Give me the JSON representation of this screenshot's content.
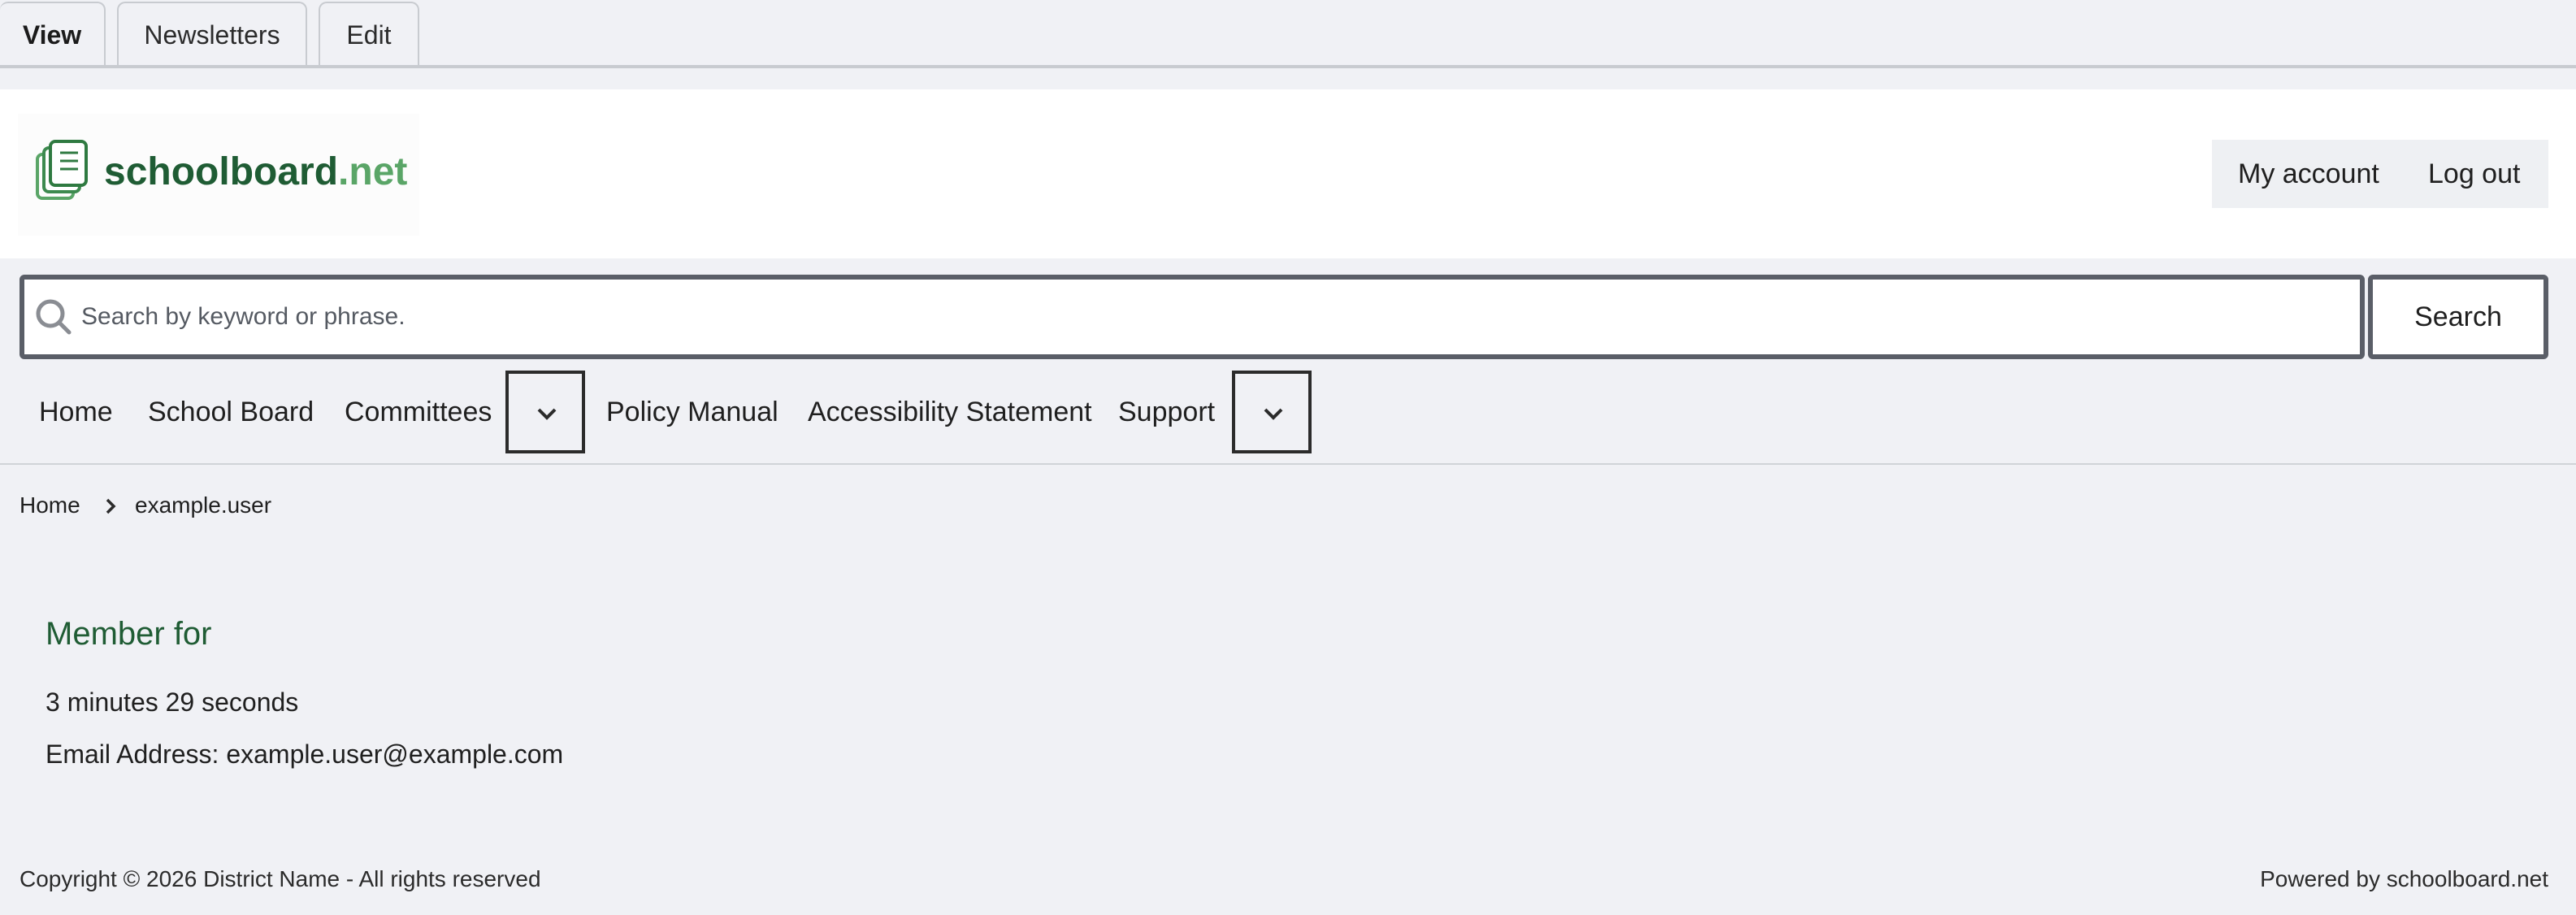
{
  "tabs": [
    {
      "label": "View",
      "active": true
    },
    {
      "label": "Newsletters",
      "active": false
    },
    {
      "label": "Edit",
      "active": false
    }
  ],
  "header": {
    "logo": {
      "name": "schoolboard",
      "tld": ".net",
      "icon": "documents-icon"
    },
    "account_links": [
      "My account",
      "Log out"
    ]
  },
  "search": {
    "placeholder": "Search by keyword or phrase.",
    "value": "",
    "button_label": "Search",
    "icon": "search-icon"
  },
  "nav": {
    "items": [
      "Home",
      "School Board",
      "Committees",
      "Policy Manual",
      "Accessibility Statement",
      "Support"
    ],
    "toggle_icon": "chevron-down-icon"
  },
  "breadcrumb": {
    "items": [
      "Home",
      "example.user"
    ],
    "separator_icon": "chevron-right-icon"
  },
  "profile": {
    "member_for_label": "Member for",
    "member_for_value": "3 minutes 29 seconds",
    "email_line": "Email Address: example.user@example.com"
  },
  "footer": {
    "copyright": "Copyright © 2026 District Name - All rights reserved",
    "powered_by": "Powered by schoolboard.net"
  },
  "colors": {
    "brand_green": "#1f5c34",
    "brand_light_green": "#5aa567",
    "page_background": "#f0f1f5",
    "border_dark": "#5a5e67"
  }
}
